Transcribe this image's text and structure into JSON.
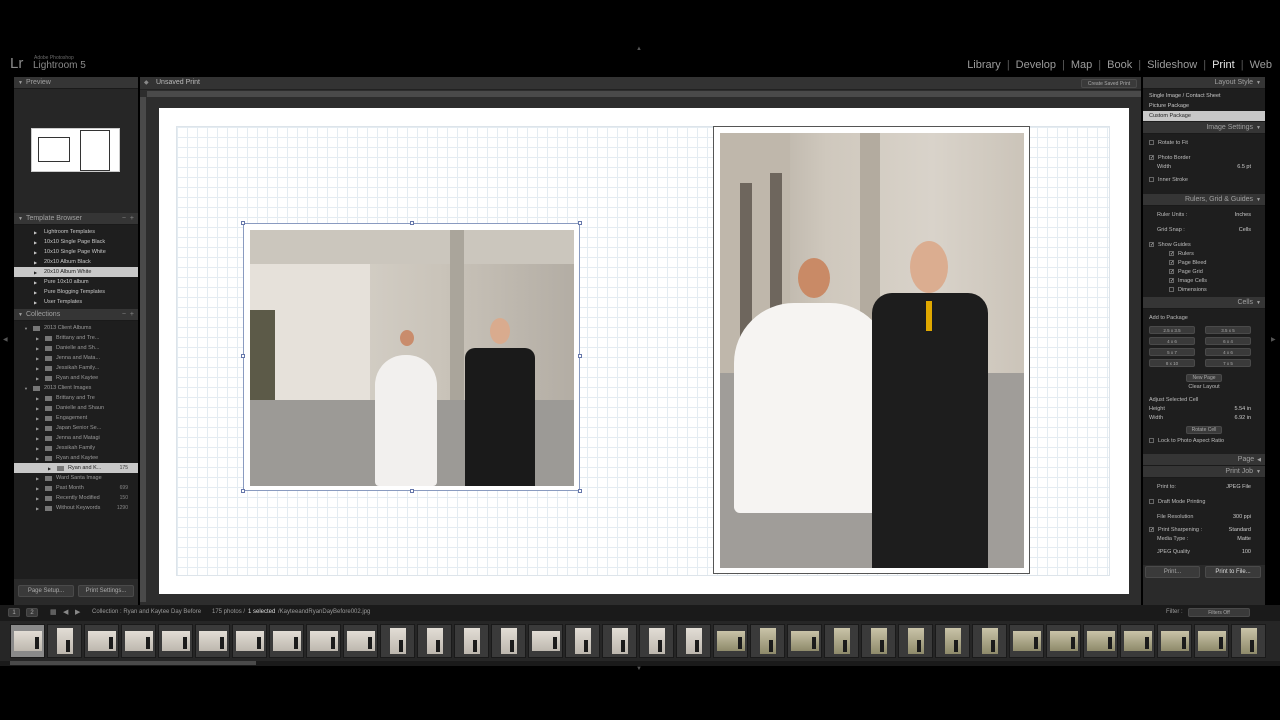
{
  "app": {
    "logo": "Lr",
    "vendor": "Adobe Photoshop",
    "name": "Lightroom 5"
  },
  "modules": [
    "Library",
    "Develop",
    "Map",
    "Book",
    "Slideshow",
    "Print",
    "Web"
  ],
  "active_module": "Print",
  "left": {
    "preview_title": "Preview",
    "template_browser_title": "Template Browser",
    "templates": [
      {
        "label": "Lightroom Templates",
        "selected": false
      },
      {
        "label": "10x10 Single Page Black",
        "selected": false
      },
      {
        "label": "10x10 Single Page White",
        "selected": false
      },
      {
        "label": "20x10 Album Black",
        "selected": false
      },
      {
        "label": "20x10 Album White",
        "selected": true
      },
      {
        "label": "Pure 10x10 album",
        "selected": false
      },
      {
        "label": "Pure Blogging Templates",
        "selected": false
      },
      {
        "label": "User Templates",
        "selected": false
      }
    ],
    "collections_title": "Collections",
    "collections": [
      {
        "label": "2013 Client Albums",
        "indent": 1,
        "count": "",
        "selected": false
      },
      {
        "label": "Brittany and Tre...",
        "indent": 2,
        "count": "",
        "selected": false
      },
      {
        "label": "Danielle and Sh...",
        "indent": 2,
        "count": "",
        "selected": false
      },
      {
        "label": "Jenna and Mata...",
        "indent": 2,
        "count": "",
        "selected": false
      },
      {
        "label": "Jessikah Family...",
        "indent": 2,
        "count": "",
        "selected": false
      },
      {
        "label": "Ryan and Kaytee",
        "indent": 2,
        "count": "",
        "selected": false
      },
      {
        "label": "2013 Client Images",
        "indent": 1,
        "count": "",
        "selected": false
      },
      {
        "label": "Brittany and Tre",
        "indent": 2,
        "count": "",
        "selected": false
      },
      {
        "label": "Danielle and Shaun",
        "indent": 2,
        "count": "",
        "selected": false
      },
      {
        "label": "Engagement",
        "indent": 2,
        "count": "",
        "selected": false
      },
      {
        "label": "Japan Senior Se...",
        "indent": 2,
        "count": "",
        "selected": false
      },
      {
        "label": "Jenna and Matagi",
        "indent": 2,
        "count": "",
        "selected": false
      },
      {
        "label": "Jessikah Family",
        "indent": 2,
        "count": "",
        "selected": false
      },
      {
        "label": "Ryan and Kaytee",
        "indent": 2,
        "count": "",
        "selected": false
      },
      {
        "label": "Ryan and K...",
        "indent": 3,
        "count": "175",
        "selected": true
      },
      {
        "label": "Ward Santa Image",
        "indent": 2,
        "count": "",
        "selected": false
      },
      {
        "label": "Past Month",
        "indent": 2,
        "count": "699",
        "selected": false
      },
      {
        "label": "Recently Modified",
        "indent": 2,
        "count": "150",
        "selected": false
      },
      {
        "label": "Without Keywords",
        "indent": 2,
        "count": "1290",
        "selected": false
      }
    ],
    "page_setup_btn": "Page Setup...",
    "print_settings_btn": "Print Settings..."
  },
  "center": {
    "tab_title": "Unsaved Print",
    "create_saved_print": "Create Saved Print"
  },
  "right": {
    "layout_style_title": "Layout Style",
    "layout_styles": [
      {
        "label": "Single Image / Contact Sheet",
        "selected": false
      },
      {
        "label": "Picture Package",
        "selected": false
      },
      {
        "label": "Custom Package",
        "selected": true
      }
    ],
    "image_settings_title": "Image Settings",
    "rotate_to_fit": "Rotate to Fit",
    "photo_border": "Photo Border",
    "width_label": "Width",
    "width_value": "6.5 pt",
    "inner_stroke": "Inner Stroke",
    "rulers_title": "Rulers, Grid & Guides",
    "ruler_units_label": "Ruler Units :",
    "ruler_units_value": "Inches",
    "grid_snap_label": "Grid Snap :",
    "grid_snap_value": "Cells",
    "show_guides": "Show Guides",
    "guides": [
      "Rulers",
      "Page Bleed",
      "Page Grid",
      "Image Cells",
      "Dimensions"
    ],
    "cells_title": "Cells",
    "add_to_package": "Add to Package",
    "cell_sizes": [
      "2.5 x 3.5",
      "4 x 6",
      "5 x 7",
      "8 x 10",
      "3.5 x 5",
      "6 x 4",
      "4 x 6",
      "7 x 5"
    ],
    "new_page": "New Page",
    "clear_layout": "Clear Layout",
    "adjust_selected_cell": "Adjust Selected Cell",
    "height_label": "Height",
    "height_value": "5.54 in",
    "cell_width_label": "Width",
    "cell_width_value": "6.92 in",
    "rotate_cell": "Rotate Cell",
    "lock_aspect": "Lock to Photo Aspect Ratio",
    "page_title": "Page",
    "print_job_title": "Print Job",
    "print_to_label": "Print to:",
    "print_to_value": "JPEG File",
    "draft_mode": "Draft Mode Printing",
    "file_resolution_label": "File Resolution",
    "file_resolution_value": "300 ppi",
    "print_sharpening_label": "Print Sharpening :",
    "print_sharpening_value": "Standard",
    "media_type_label": "Media Type :",
    "media_type_value": "Matte",
    "jpeg_quality_label": "JPEG Quality",
    "jpeg_quality_value": "100",
    "print_btn": "Print...",
    "print_to_file_btn": "Print to File..."
  },
  "filmstrip": {
    "page_1": "1",
    "page_2": "2",
    "collection_text": "Collection : Ryan and Kaytee Day Before",
    "count_text": "175 photos /",
    "selected_text": "1 selected",
    "file_text": "/KayteeandRyanDayBefore002.jpg",
    "filter_label": "Filter :",
    "filter_value": "Filters Off"
  }
}
